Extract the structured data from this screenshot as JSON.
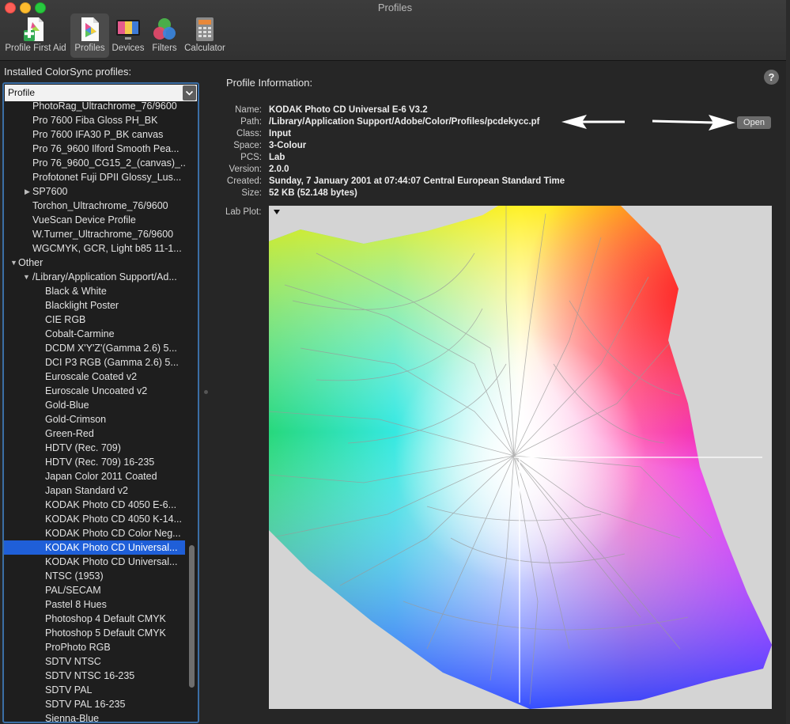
{
  "window": {
    "title": "Profiles"
  },
  "toolbar": [
    {
      "label": "Profile First Aid",
      "icon": "profile-first-aid-icon"
    },
    {
      "label": "Profiles",
      "icon": "profiles-icon",
      "selected": true
    },
    {
      "label": "Devices",
      "icon": "devices-icon"
    },
    {
      "label": "Filters",
      "icon": "filters-icon"
    },
    {
      "label": "Calculator",
      "icon": "calculator-icon"
    }
  ],
  "sidebar": {
    "heading": "Installed ColorSync profiles:",
    "popup_value": "Profile",
    "rows": [
      {
        "text": "PhotoRag_Ultrachrome_76/9600",
        "level": 2
      },
      {
        "text": "Pro 7600 Fiba Gloss PH_BK",
        "level": 2
      },
      {
        "text": "Pro 7600 IFA30 P_BK canvas",
        "level": 2
      },
      {
        "text": "Pro 76_9600 Ilford Smooth Pea...",
        "level": 2
      },
      {
        "text": "Pro 76_9600_CG15_2_(canvas)_...",
        "level": 2
      },
      {
        "text": "Profotonet Fuji DPII Glossy_Lus...",
        "level": 2
      },
      {
        "text": "SP7600",
        "level": 2,
        "disclosure": "collapsed"
      },
      {
        "text": "Torchon_Ultrachrome_76/9600",
        "level": 2
      },
      {
        "text": "VueScan Device Profile",
        "level": 2
      },
      {
        "text": "W.Turner_Ultrachrome_76/9600",
        "level": 2
      },
      {
        "text": "WGCMYK, GCR, Light b85 11-1...",
        "level": 2
      },
      {
        "text": "Other",
        "level": 0,
        "disclosure": "expanded"
      },
      {
        "text": "/Library/Application Support/Ad...",
        "level": 1,
        "disclosure": "expanded"
      },
      {
        "text": "Black & White",
        "level": 3
      },
      {
        "text": "Blacklight Poster",
        "level": 3
      },
      {
        "text": "CIE RGB",
        "level": 3
      },
      {
        "text": "Cobalt-Carmine",
        "level": 3
      },
      {
        "text": "DCDM X'Y'Z'(Gamma 2.6) 5...",
        "level": 3
      },
      {
        "text": "DCI P3 RGB (Gamma 2.6) 5...",
        "level": 3
      },
      {
        "text": "Euroscale Coated v2",
        "level": 3
      },
      {
        "text": "Euroscale Uncoated v2",
        "level": 3
      },
      {
        "text": "Gold-Blue",
        "level": 3
      },
      {
        "text": "Gold-Crimson",
        "level": 3
      },
      {
        "text": "Green-Red",
        "level": 3
      },
      {
        "text": "HDTV (Rec. 709)",
        "level": 3
      },
      {
        "text": "HDTV (Rec. 709) 16-235",
        "level": 3
      },
      {
        "text": "Japan Color 2011 Coated",
        "level": 3
      },
      {
        "text": "Japan Standard v2",
        "level": 3
      },
      {
        "text": "KODAK Photo CD 4050 E-6...",
        "level": 3
      },
      {
        "text": "KODAK Photo CD 4050 K-14...",
        "level": 3
      },
      {
        "text": "KODAK Photo CD Color Neg...",
        "level": 3
      },
      {
        "text": "KODAK Photo CD Universal...",
        "level": 3,
        "selected": true
      },
      {
        "text": "KODAK Photo CD Universal...",
        "level": 3
      },
      {
        "text": "NTSC (1953)",
        "level": 3
      },
      {
        "text": "PAL/SECAM",
        "level": 3
      },
      {
        "text": "Pastel 8 Hues",
        "level": 3
      },
      {
        "text": "Photoshop 4 Default CMYK",
        "level": 3
      },
      {
        "text": "Photoshop 5 Default CMYK",
        "level": 3
      },
      {
        "text": "ProPhoto RGB",
        "level": 3
      },
      {
        "text": "SDTV NTSC",
        "level": 3
      },
      {
        "text": "SDTV NTSC 16-235",
        "level": 3
      },
      {
        "text": "SDTV PAL",
        "level": 3
      },
      {
        "text": "SDTV PAL 16-235",
        "level": 3
      },
      {
        "text": "Sienna-Blue",
        "level": 3
      }
    ]
  },
  "profile_info": {
    "heading": "Profile Information:",
    "fields": [
      {
        "key": "Name:",
        "value": "KODAK Photo CD Universal E-6 V3.2"
      },
      {
        "key": "Path:",
        "value": "/Library/Application Support/Adobe/Color/Profiles/pcdekycc.pf"
      },
      {
        "key": "Class:",
        "value": "Input"
      },
      {
        "key": "Space:",
        "value": "3-Colour"
      },
      {
        "key": "PCS:",
        "value": "Lab"
      },
      {
        "key": "Version:",
        "value": "2.0.0"
      },
      {
        "key": "Created:",
        "value": "Sunday, 7 January 2001 at 07:44:07 Central European Standard Time"
      },
      {
        "key": "Size:",
        "value": "52 KB (52.148 bytes)"
      }
    ],
    "open_label": "Open",
    "lab_plot_label": "Lab Plot:",
    "help_label": "?"
  }
}
